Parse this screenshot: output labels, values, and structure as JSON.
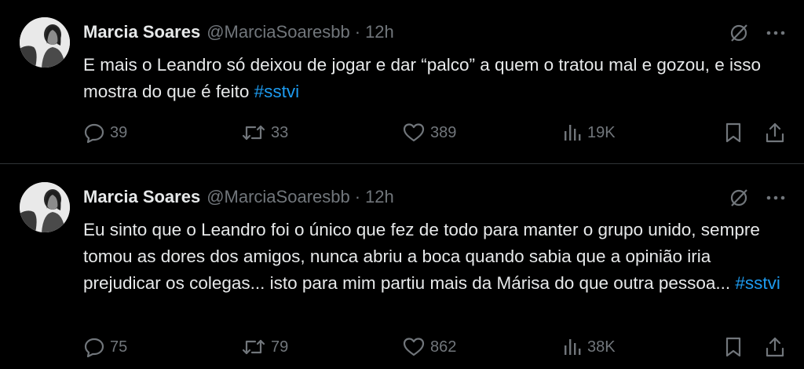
{
  "tweets": [
    {
      "name": "Marcia Soares",
      "handle": "@MarciaSoaresbb",
      "separator": "·",
      "time": "12h",
      "text": "E mais o Leandro só deixou de jogar e dar “palco” a quem o tratou mal e gozou, e isso mostra do que é feito ",
      "hashtag": "#sstvi",
      "replies": "39",
      "retweets": "33",
      "likes": "389",
      "views": "19K"
    },
    {
      "name": "Marcia Soares",
      "handle": "@MarciaSoaresbb",
      "separator": "·",
      "time": "12h",
      "text": "Eu sinto que o Leandro foi o único que fez de todo para manter o grupo unido, sempre tomou as dores dos amigos, nunca abriu a boca quando sabia que a opinião iria prejudicar os colegas... isto para mim partiu mais da Márisa do que outra pessoa... ",
      "hashtag": "#sstvi",
      "replies": "75",
      "retweets": "79",
      "likes": "862",
      "views": "38K"
    }
  ],
  "colors": {
    "background": "#000000",
    "text": "#e7e9ea",
    "muted": "#71767b",
    "link": "#1d9bf0",
    "divider": "#2f3336"
  },
  "icons": [
    "avatar",
    "grok-icon",
    "more-icon",
    "reply-icon",
    "retweet-icon",
    "like-icon",
    "views-icon",
    "bookmark-icon",
    "share-icon"
  ]
}
